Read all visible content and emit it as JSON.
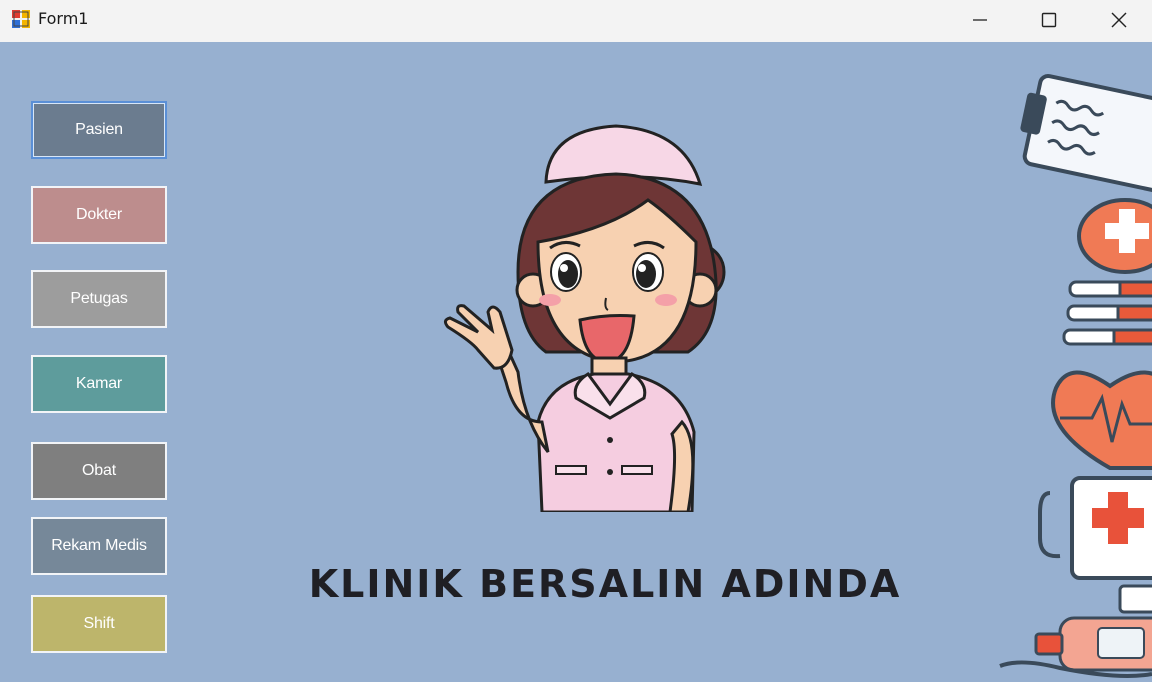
{
  "window": {
    "title": "Form1",
    "icon": "form-app-icon",
    "controls": {
      "minimize": "minimize-icon",
      "maximize": "maximize-icon",
      "close": "close-icon"
    }
  },
  "menu": {
    "buttons": [
      {
        "label": "Pasien",
        "color": "#6b7c8f"
      },
      {
        "label": "Dokter",
        "color": "#bd8d8d"
      },
      {
        "label": "Petugas",
        "color": "#9d9d9d"
      },
      {
        "label": "Kamar",
        "color": "#5e9c9c"
      },
      {
        "label": "Obat",
        "color": "#7f7f7f"
      },
      {
        "label": "Rekam Medis",
        "color": "#768899"
      },
      {
        "label": "Shift",
        "color": "#bdb56b"
      }
    ]
  },
  "banner": {
    "text": "KLINIK BERSALIN ADINDA"
  },
  "colors": {
    "background": "#97b0d0",
    "titlebar": "#f3f3f3"
  }
}
